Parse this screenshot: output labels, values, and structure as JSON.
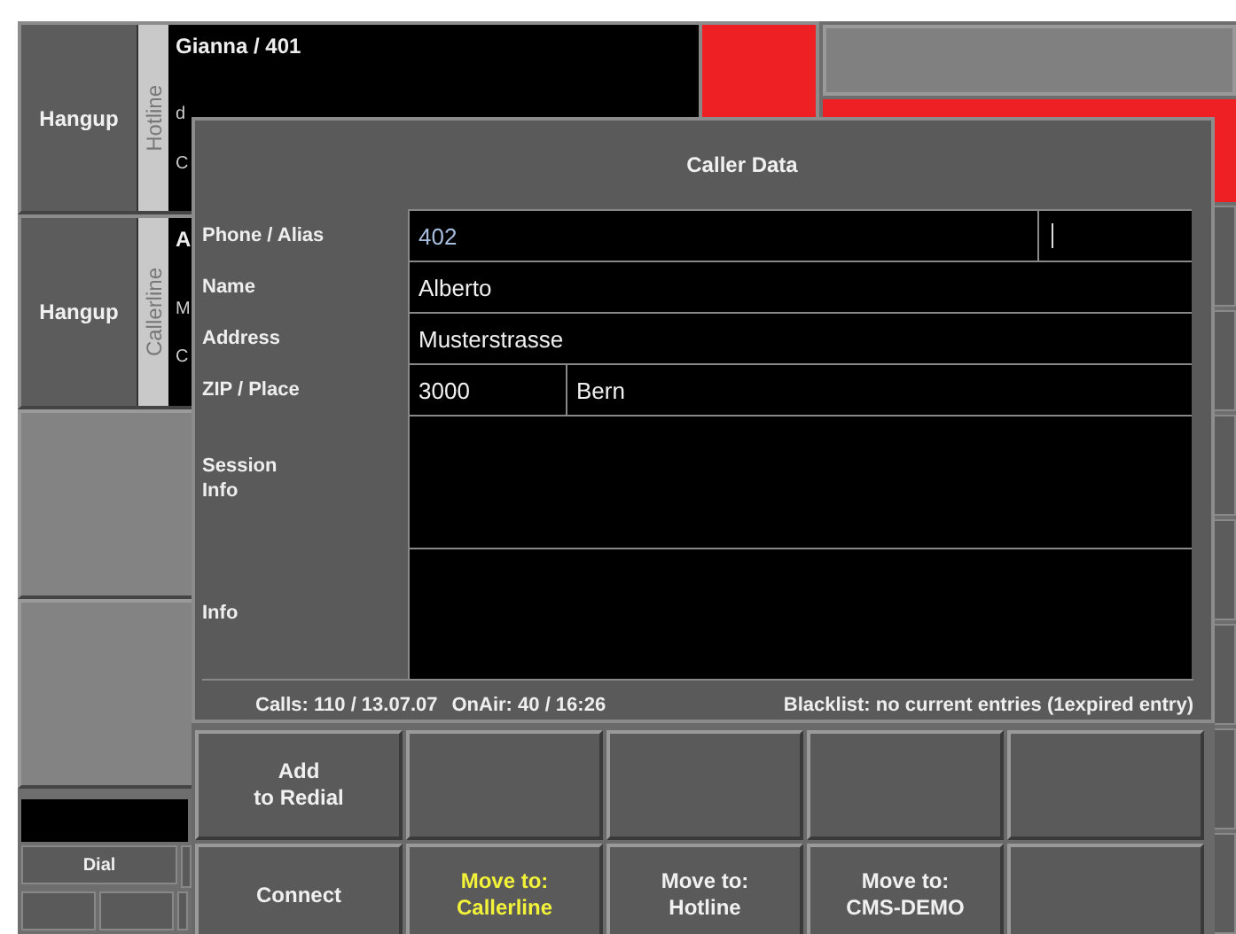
{
  "lines": [
    {
      "hangup": "Hangup",
      "line_label": "Hotline",
      "caller": "Gianna / 401",
      "peek": [
        "d",
        "C"
      ],
      "on_air": true
    },
    {
      "hangup": "Hangup",
      "line_label": "Callerline",
      "caller": "A",
      "peek": [
        "M",
        "C"
      ],
      "on_air": false
    }
  ],
  "dial_button": "Dial",
  "dialog": {
    "title": "Caller Data",
    "fields": [
      {
        "label": "Phone / Alias",
        "kind": "single",
        "cells": [
          {
            "value": "402",
            "highlight": true,
            "cursor": false
          },
          {
            "highlight": false,
            "cursor": true
          }
        ]
      },
      {
        "label": "Name",
        "kind": "single",
        "cells": [
          {
            "value": "Alberto",
            "highlight": false,
            "cursor": false
          }
        ]
      },
      {
        "label": "Address",
        "kind": "single",
        "cells": [
          {
            "value": "Musterstrasse",
            "highlight": false,
            "cursor": false
          }
        ]
      },
      {
        "label": "ZIP / Place",
        "kind": "single",
        "cells": [
          {
            "value": "3000",
            "highlight": false,
            "cursor": false
          },
          {
            "value": "Bern",
            "highlight": false,
            "cursor": false
          }
        ]
      },
      {
        "label": "Session\nInfo",
        "kind": "area"
      },
      {
        "label": "Info",
        "kind": "area"
      }
    ],
    "stats": [
      "Calls: 110 / 13.07.07",
      "OnAir: 40 / 16:26",
      "Blacklist: no current entries (1expired entry)"
    ],
    "button_rows": [
      [
        {
          "kind": "action",
          "label": "Add\nto Redial",
          "highlight": false
        },
        {
          "kind": "blank"
        },
        {
          "kind": "blank"
        },
        {
          "kind": "blank"
        },
        {
          "kind": "blank"
        }
      ],
      [
        {
          "kind": "action",
          "label": "Connect",
          "highlight": false
        },
        {
          "kind": "action",
          "label": "Move to:\nCallerline",
          "highlight": true
        },
        {
          "kind": "action",
          "label": "Move to:\nHotline",
          "highlight": false
        },
        {
          "kind": "action",
          "label": "Move to:\nCMS-DEMO",
          "highlight": false
        },
        {
          "kind": "blank"
        }
      ]
    ]
  }
}
